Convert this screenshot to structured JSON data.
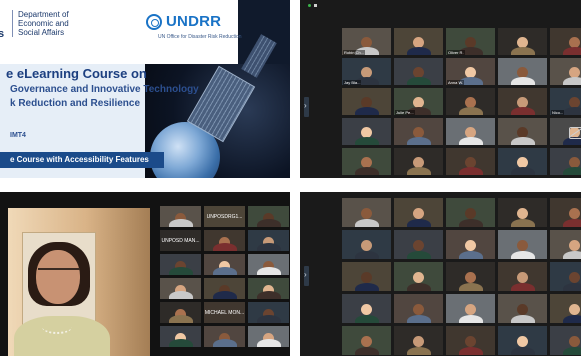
{
  "slide": {
    "edge_letter": "s",
    "dept": "Department of Economic and Social Affairs",
    "undrr": "UNDRR",
    "undrr_sub": "UN Office for Disaster Risk Reduction",
    "title_line1": "e eLearning Course on",
    "title_line2": "Governance and Innovative Technology",
    "title_line3": "k Reduction and Resilience",
    "tag": "IMT4",
    "band": "e Course with Accessibility Features"
  },
  "top_gallery": {
    "names": [
      "Robin Ch...",
      "",
      "Oliver R.",
      "",
      "",
      "Jay Bla...",
      "",
      "Anna W.",
      "",
      "",
      "",
      "Julie Pe...",
      "",
      "",
      "Nico...",
      "",
      "",
      "",
      "",
      "",
      "",
      "",
      "",
      "",
      ""
    ]
  },
  "bottom_gallery": {
    "names": [
      "",
      "",
      "",
      "",
      "",
      "",
      "",
      "",
      "",
      "",
      "",
      "",
      "",
      "",
      "",
      "",
      "",
      "",
      "",
      "",
      "",
      "",
      "",
      "",
      ""
    ]
  },
  "speaker_panel": {
    "tiles": [
      {
        "name": ""
      },
      {
        "name": "UNPOSDRG1...",
        "text_only": true
      },
      {
        "name": ""
      },
      {
        "name": "UNPOSD MAN...",
        "text_only": true
      },
      {
        "name": ""
      },
      {
        "name": ""
      },
      {
        "name": ""
      },
      {
        "name": ""
      },
      {
        "name": ""
      },
      {
        "name": ""
      },
      {
        "name": ""
      },
      {
        "name": ""
      },
      {
        "name": ""
      },
      {
        "name": "MICHAEL MON...",
        "text_only": true
      },
      {
        "name": ""
      },
      {
        "name": ""
      },
      {
        "name": ""
      },
      {
        "name": ""
      }
    ]
  }
}
